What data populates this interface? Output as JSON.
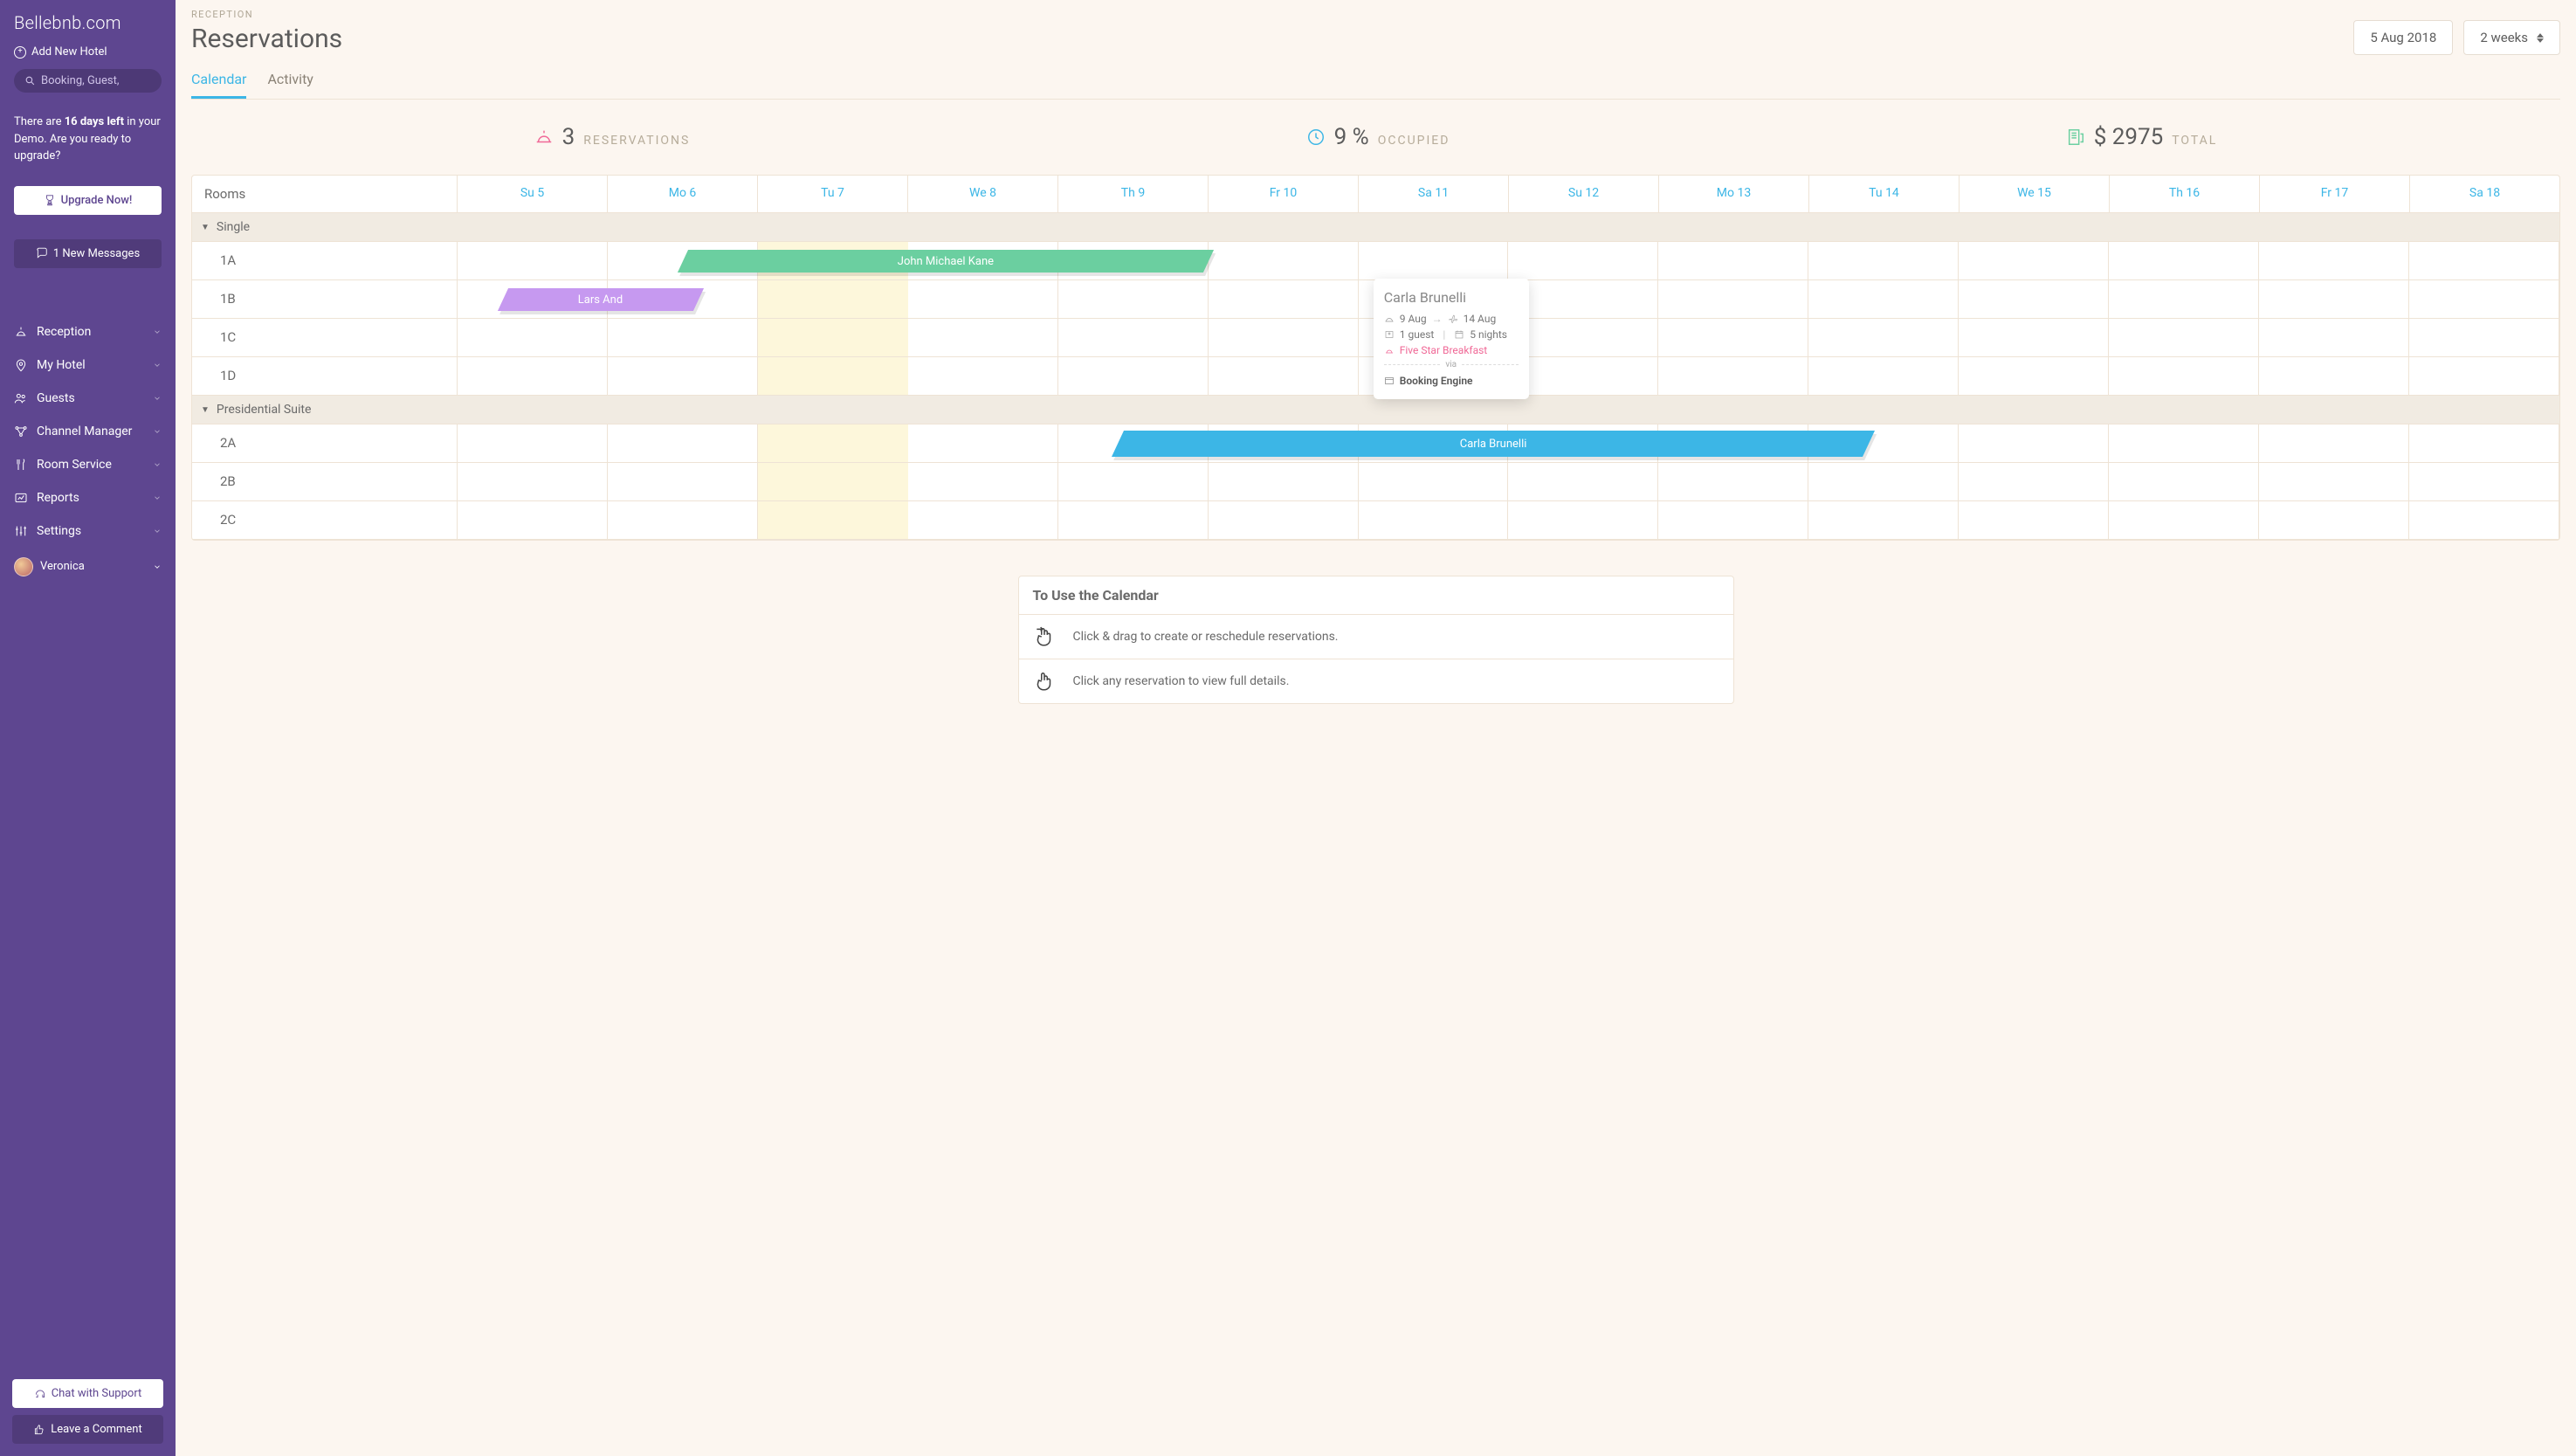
{
  "brand": "Bellebnb.com",
  "add_hotel": "Add New Hotel",
  "search_placeholder": "Booking, Guest,",
  "demo_banner": {
    "prefix": "There are ",
    "bold": "16 days left",
    "suffix": " in your Demo. Are you ready to upgrade?"
  },
  "upgrade_btn": "Upgrade Now!",
  "messages_btn": "1 New Messages",
  "nav": {
    "reception": "Reception",
    "my_hotel": "My Hotel",
    "guests": "Guests",
    "channel_manager": "Channel Manager",
    "room_service": "Room Service",
    "reports": "Reports",
    "settings": "Settings"
  },
  "user_name": "Veronica",
  "chat_support": "Chat with Support",
  "leave_comment": "Leave a Comment",
  "eyebrow": "RECEPTION",
  "page_title": "Reservations",
  "date_btn": "5 Aug 2018",
  "range_btn": "2 weeks",
  "tabs": {
    "calendar": "Calendar",
    "activity": "Activity"
  },
  "stats": {
    "reservations_count": "3",
    "reservations_lbl": "RESERVATIONS",
    "occupied_pct": "9 %",
    "occupied_lbl": "OCCUPIED",
    "total_amount": "$ 2975",
    "total_lbl": "TOTAL"
  },
  "calendar": {
    "rooms_header": "Rooms",
    "days": [
      "Su 5",
      "Mo 6",
      "Tu 7",
      "We 8",
      "Th 9",
      "Fr 10",
      "Sa 11",
      "Su 12",
      "Mo 13",
      "Tu 14",
      "We 15",
      "Th 16",
      "Fr 17",
      "Sa 18"
    ],
    "groups": [
      {
        "name": "Single",
        "rooms": [
          "1A",
          "1B",
          "1C",
          "1D"
        ]
      },
      {
        "name": "Presidential Suite",
        "rooms": [
          "2A",
          "2B",
          "2C"
        ]
      }
    ],
    "reservations": {
      "john": "John Michael Kane",
      "lars": "Lars And",
      "carla": "Carla Brunelli"
    }
  },
  "popover": {
    "name": "Carla Brunelli",
    "checkin": "9 Aug",
    "checkout": "14 Aug",
    "guests": "1 guest",
    "nights": "5 nights",
    "meal": "Five Star Breakfast",
    "via": "via",
    "source": "Booking Engine"
  },
  "help": {
    "title": "To Use the Calendar",
    "line1": "Click & drag to create or reschedule reservations.",
    "line2": "Click any reservation to view full details."
  }
}
